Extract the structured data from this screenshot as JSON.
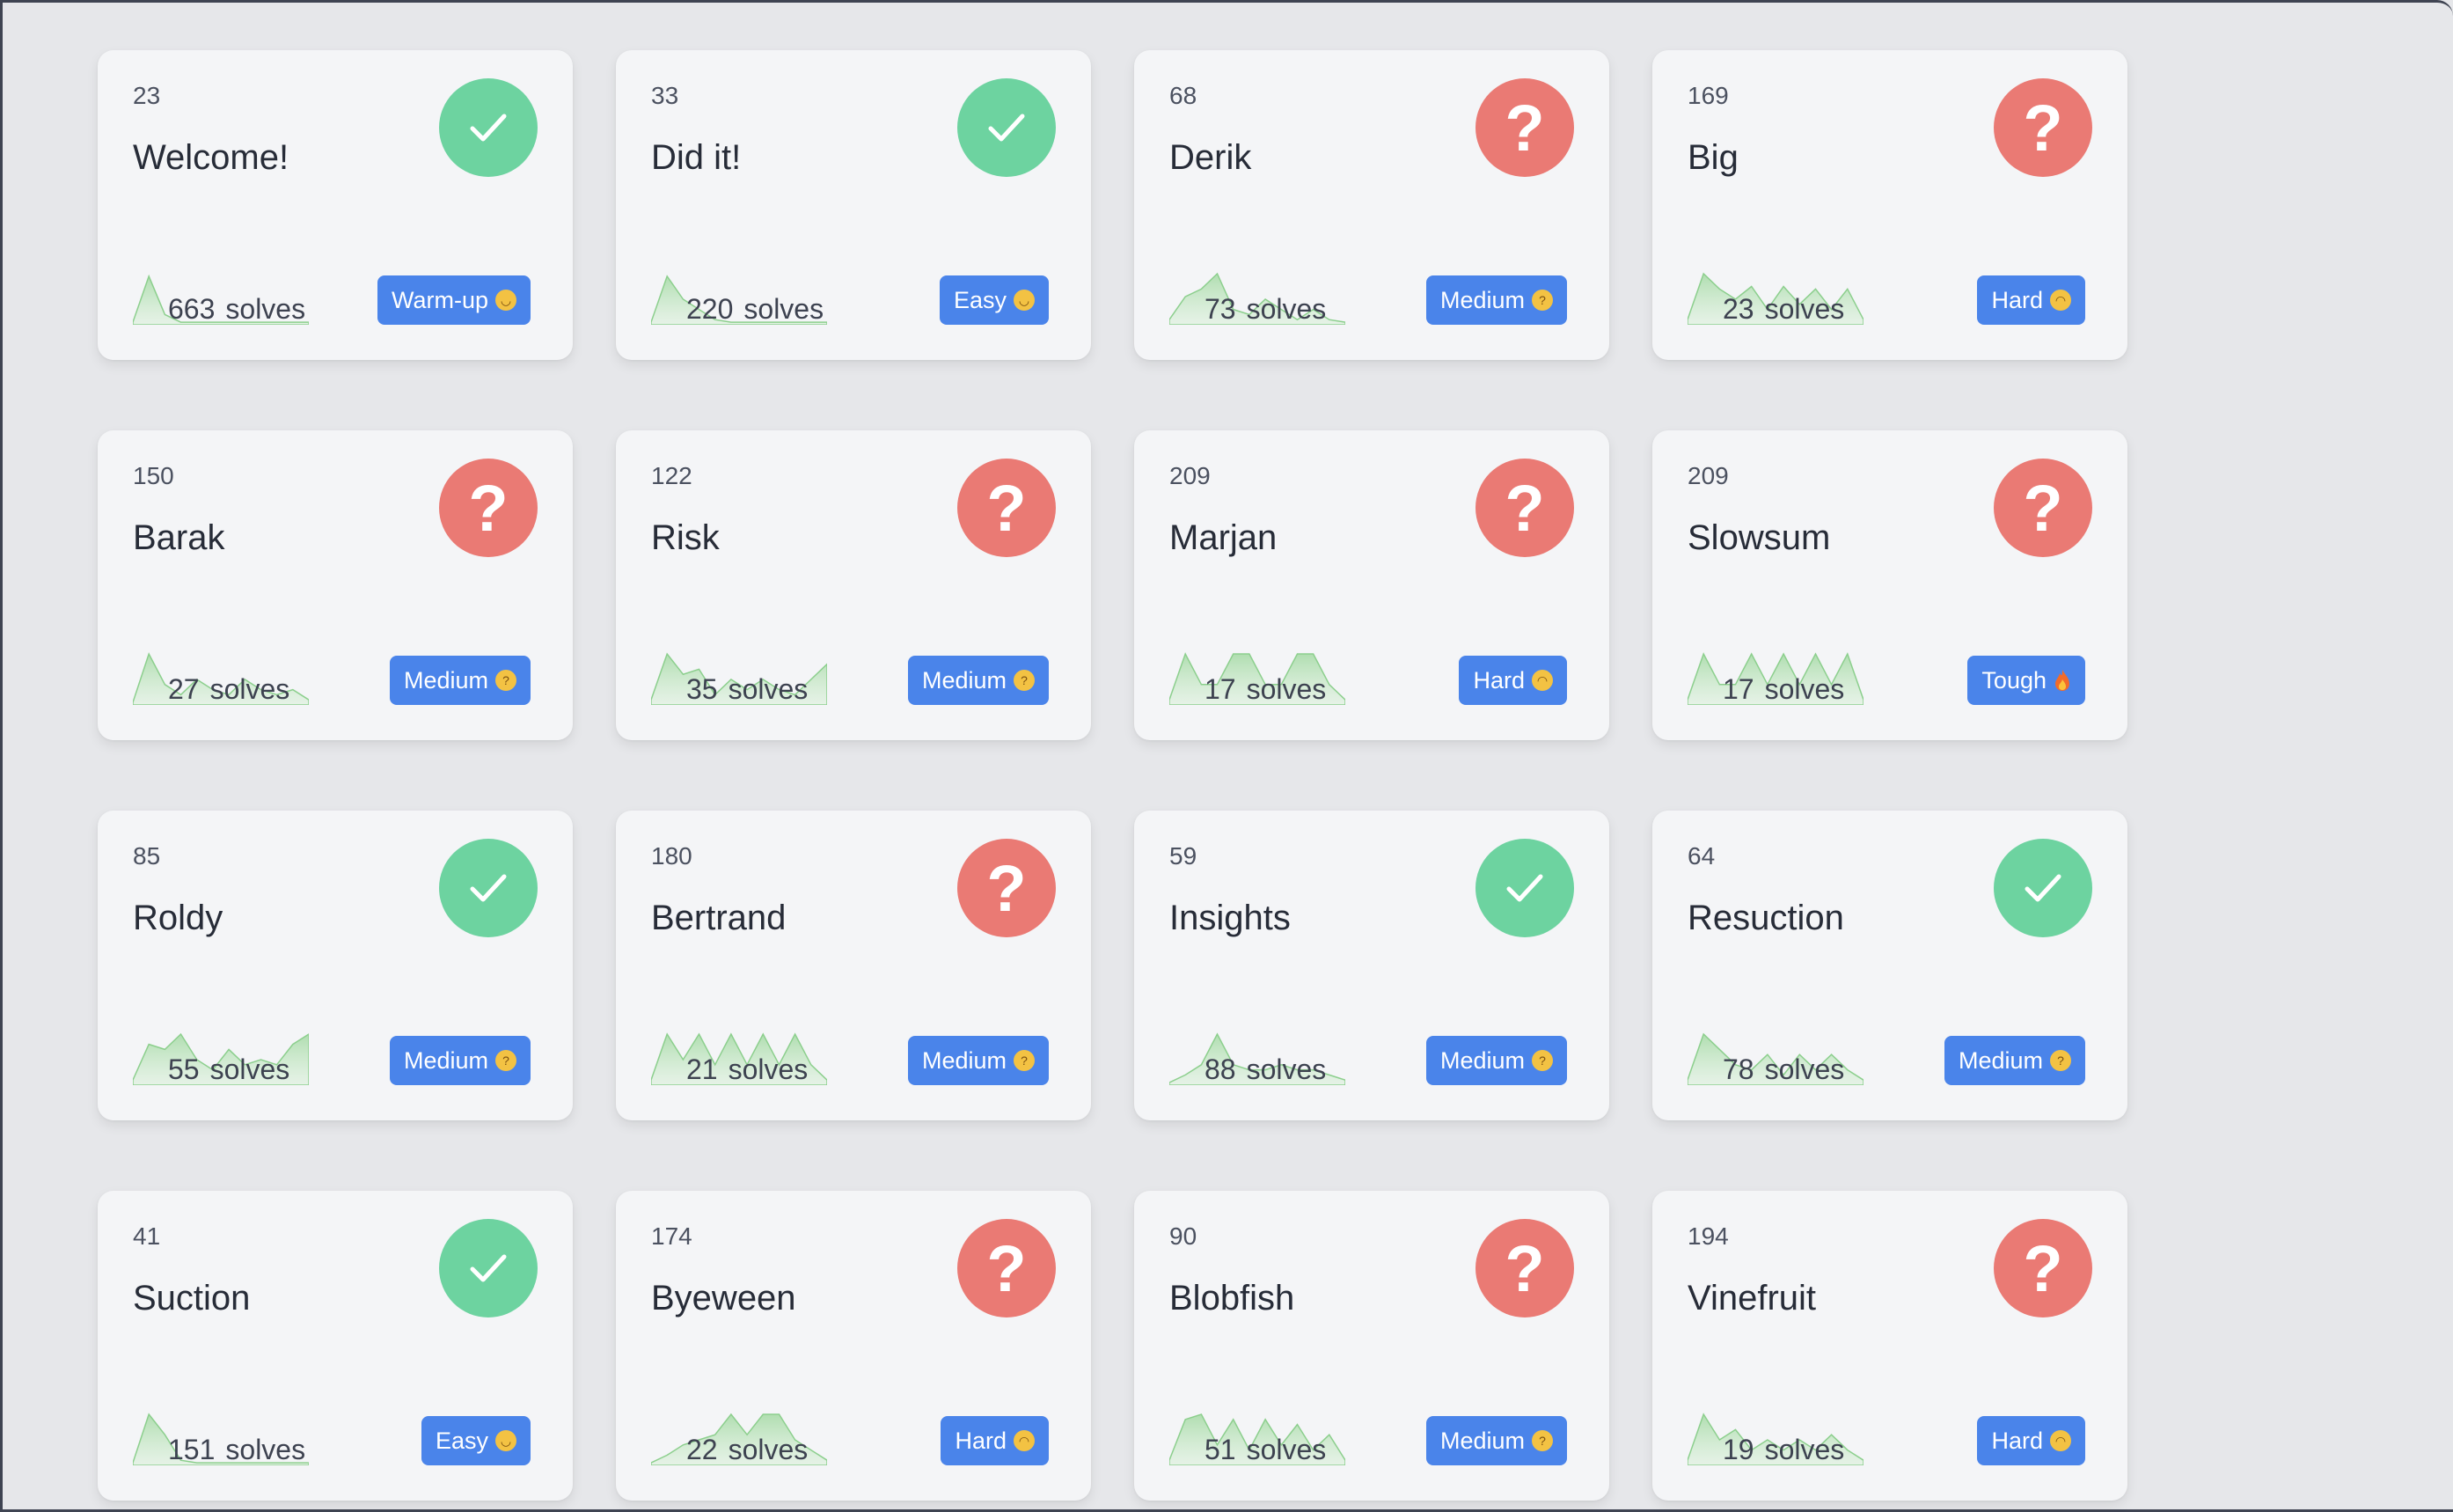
{
  "solves_label": "solves",
  "colors": {
    "solved": "#6dd3a0",
    "unsolved": "#ea7a74",
    "badge": "#4a84ea",
    "sparkline": "#a8dba8"
  },
  "difficulty_icons": {
    "Warm-up": "grinning-face-icon",
    "Easy": "smiling-face-icon",
    "Medium": "thinking-face-icon",
    "Hard": "worried-face-icon",
    "Tough": "fire-icon"
  },
  "challenges": [
    {
      "points": "23",
      "name": "Welcome!",
      "solved": true,
      "solves": "663",
      "difficulty": "Warm-up",
      "spark": [
        0.05,
        0.95,
        0.2,
        0.05,
        0.05,
        0.05,
        0.05,
        0.05,
        0.05,
        0.05,
        0.05,
        0.05
      ]
    },
    {
      "points": "33",
      "name": "Did it!",
      "solved": true,
      "solves": "220",
      "difficulty": "Easy",
      "spark": [
        0.05,
        0.95,
        0.5,
        0.3,
        0.1,
        0.05,
        0.05,
        0.05,
        0.05,
        0.05,
        0.05,
        0.05
      ]
    },
    {
      "points": "68",
      "name": "Derik",
      "solved": false,
      "solves": "73",
      "difficulty": "Medium",
      "spark": [
        0.1,
        0.55,
        0.7,
        1.0,
        0.3,
        0.2,
        0.5,
        0.3,
        0.1,
        0.3,
        0.1,
        0.05
      ]
    },
    {
      "points": "169",
      "name": "Big",
      "solved": false,
      "solves": "23",
      "difficulty": "Hard",
      "spark": [
        0.1,
        1.0,
        0.7,
        0.5,
        0.75,
        0.3,
        0.75,
        0.4,
        0.7,
        0.3,
        0.7,
        0.1
      ]
    },
    {
      "points": "150",
      "name": "Barak",
      "solved": false,
      "solves": "27",
      "difficulty": "Medium",
      "spark": [
        0.05,
        1.0,
        0.4,
        0.2,
        0.5,
        0.3,
        0.2,
        0.5,
        0.3,
        0.2,
        0.3,
        0.1
      ]
    },
    {
      "points": "122",
      "name": "Risk",
      "solved": false,
      "solves": "35",
      "difficulty": "Medium",
      "spark": [
        0.1,
        1.0,
        0.6,
        0.7,
        0.2,
        0.5,
        0.3,
        0.5,
        0.3,
        0.2,
        0.5,
        0.8
      ]
    },
    {
      "points": "209",
      "name": "Marjan",
      "solved": false,
      "solves": "17",
      "difficulty": "Hard",
      "spark": [
        0.1,
        1.0,
        0.4,
        0.4,
        1.0,
        1.0,
        0.4,
        0.4,
        1.0,
        1.0,
        0.4,
        0.1
      ]
    },
    {
      "points": "209",
      "name": "Slowsum",
      "solved": false,
      "solves": "17",
      "difficulty": "Tough",
      "spark": [
        0.1,
        1.0,
        0.4,
        0.4,
        1.0,
        0.4,
        1.0,
        0.4,
        1.0,
        0.4,
        1.0,
        0.1
      ]
    },
    {
      "points": "85",
      "name": "Roldy",
      "solved": true,
      "solves": "55",
      "difficulty": "Medium",
      "spark": [
        0.1,
        0.8,
        0.7,
        1.0,
        0.5,
        0.3,
        0.7,
        0.4,
        0.5,
        0.4,
        0.8,
        1.0
      ]
    },
    {
      "points": "180",
      "name": "Bertrand",
      "solved": false,
      "solves": "21",
      "difficulty": "Medium",
      "spark": [
        0.1,
        1.0,
        0.5,
        1.0,
        0.4,
        1.0,
        0.4,
        1.0,
        0.4,
        1.0,
        0.4,
        0.1
      ]
    },
    {
      "points": "59",
      "name": "Insights",
      "solved": true,
      "solves": "88",
      "difficulty": "Medium",
      "spark": [
        0.05,
        0.2,
        0.4,
        1.0,
        0.4,
        0.3,
        0.3,
        0.4,
        0.3,
        0.3,
        0.2,
        0.1
      ]
    },
    {
      "points": "64",
      "name": "Resuction",
      "solved": true,
      "solves": "78",
      "difficulty": "Medium",
      "spark": [
        0.1,
        1.0,
        0.7,
        0.4,
        0.3,
        0.6,
        0.2,
        0.6,
        0.3,
        0.6,
        0.3,
        0.1
      ]
    },
    {
      "points": "41",
      "name": "Suction",
      "solved": true,
      "solves": "151",
      "difficulty": "Easy",
      "spark": [
        0.05,
        1.0,
        0.6,
        0.1,
        0.05,
        0.05,
        0.05,
        0.05,
        0.05,
        0.05,
        0.05,
        0.05
      ]
    },
    {
      "points": "174",
      "name": "Byeween",
      "solved": false,
      "solves": "22",
      "difficulty": "Hard",
      "spark": [
        0.05,
        0.2,
        0.4,
        0.5,
        0.6,
        1.0,
        0.6,
        1.0,
        1.0,
        0.5,
        0.3,
        0.1
      ]
    },
    {
      "points": "90",
      "name": "Blobfish",
      "solved": false,
      "solves": "51",
      "difficulty": "Medium",
      "spark": [
        0.1,
        0.9,
        1.0,
        0.4,
        0.9,
        0.3,
        0.9,
        0.4,
        0.8,
        0.3,
        0.6,
        0.1
      ]
    },
    {
      "points": "194",
      "name": "Vinefruit",
      "solved": false,
      "solves": "19",
      "difficulty": "Hard",
      "spark": [
        0.1,
        1.0,
        0.5,
        0.7,
        0.3,
        0.5,
        0.3,
        0.5,
        0.3,
        0.6,
        0.3,
        0.1
      ]
    }
  ]
}
